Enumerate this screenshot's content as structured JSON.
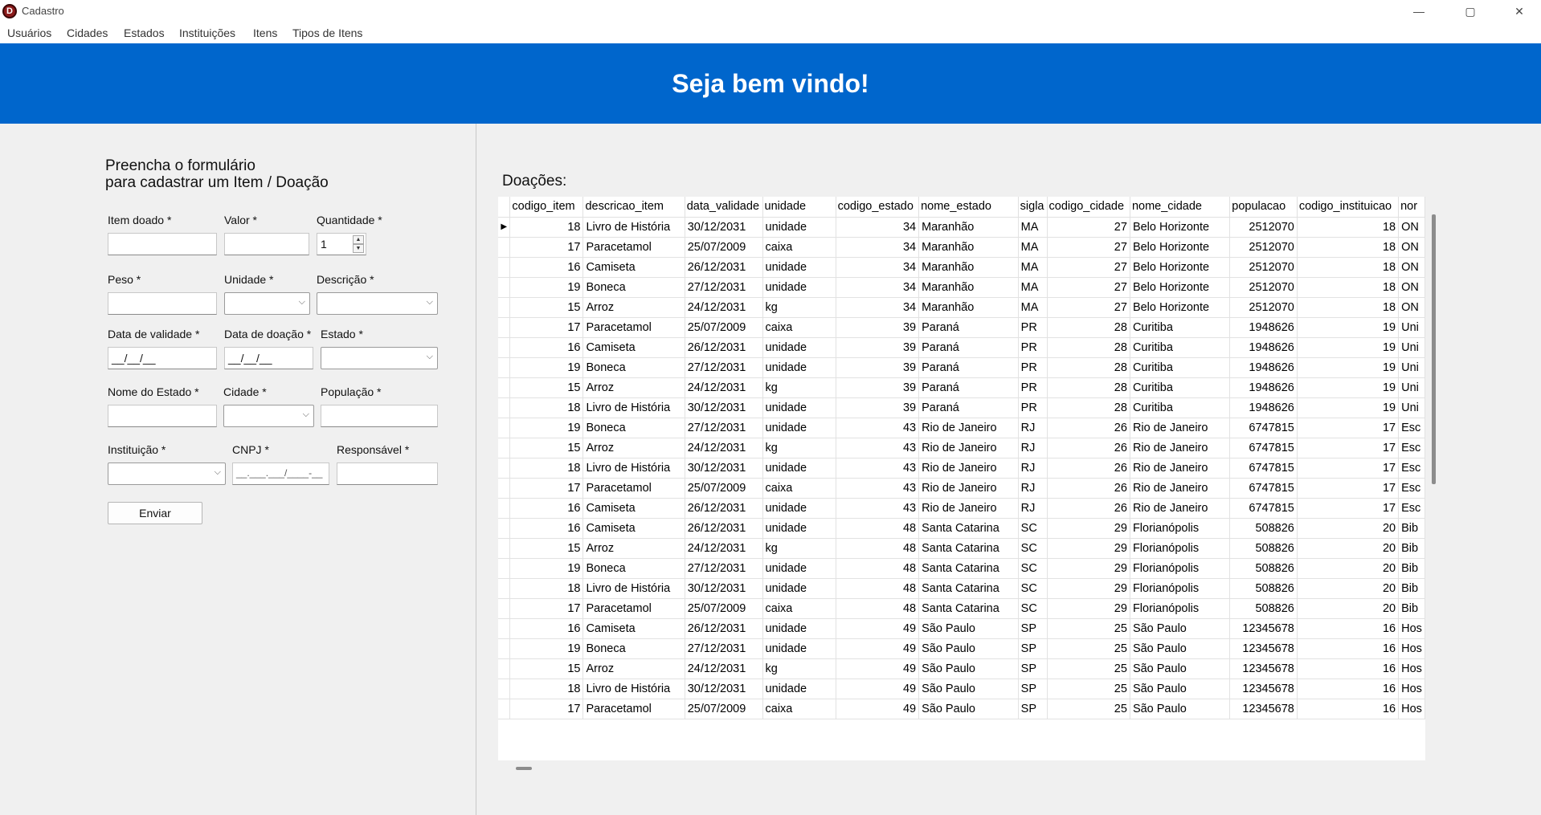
{
  "window": {
    "title": "Cadastro",
    "minimize": "—",
    "maximize": "▢",
    "close": "✕"
  },
  "menu": [
    "Usuários",
    "Cidades",
    "Estados",
    "Instituições",
    "Itens",
    "Tipos de Itens"
  ],
  "banner": {
    "title": "Seja bem vindo!",
    "color": "#0066cc"
  },
  "form": {
    "heading_line1": "Preencha o formulário",
    "heading_line2": "para cadastrar um Item / Doação",
    "labels": {
      "item_doado": "Item doado *",
      "valor": "Valor *",
      "quantidade": "Quantidade *",
      "peso": "Peso *",
      "unidade": "Unidade *",
      "descricao": "Descrição *",
      "data_validade": "Data de validade *",
      "data_doacao": "Data de doação *",
      "estado": "Estado *",
      "nome_estado": "Nome do Estado *",
      "cidade": "Cidade *",
      "populacao": "População *",
      "instituicao": "Instituição *",
      "cnpj": "CNPJ *",
      "responsavel": "Responsável *"
    },
    "values": {
      "quantidade": "1",
      "data_validade_mask": "__/__/__",
      "data_doacao_mask": "__/__/__",
      "cnpj_mask": "__.___.___/____-__"
    },
    "submit": "Enviar"
  },
  "grid": {
    "title": "Doações:",
    "columns": [
      "codigo_item",
      "descricao_item",
      "data_validade",
      "unidade",
      "codigo_estado",
      "nome_estado",
      "sigla",
      "codigo_cidade",
      "nome_cidade",
      "populacao",
      "codigo_instituicao",
      "nor"
    ],
    "rows": [
      [
        "18",
        "Livro de História",
        "30/12/2031",
        "unidade",
        "34",
        "Maranhão",
        "MA",
        "27",
        "Belo Horizonte",
        "2512070",
        "18",
        "ON"
      ],
      [
        "17",
        "Paracetamol",
        "25/07/2009",
        "caixa",
        "34",
        "Maranhão",
        "MA",
        "27",
        "Belo Horizonte",
        "2512070",
        "18",
        "ON"
      ],
      [
        "16",
        "Camiseta",
        "26/12/2031",
        "unidade",
        "34",
        "Maranhão",
        "MA",
        "27",
        "Belo Horizonte",
        "2512070",
        "18",
        "ON"
      ],
      [
        "19",
        "Boneca",
        "27/12/2031",
        "unidade",
        "34",
        "Maranhão",
        "MA",
        "27",
        "Belo Horizonte",
        "2512070",
        "18",
        "ON"
      ],
      [
        "15",
        "Arroz",
        "24/12/2031",
        "kg",
        "34",
        "Maranhão",
        "MA",
        "27",
        "Belo Horizonte",
        "2512070",
        "18",
        "ON"
      ],
      [
        "17",
        "Paracetamol",
        "25/07/2009",
        "caixa",
        "39",
        "Paraná",
        "PR",
        "28",
        "Curitiba",
        "1948626",
        "19",
        "Uni"
      ],
      [
        "16",
        "Camiseta",
        "26/12/2031",
        "unidade",
        "39",
        "Paraná",
        "PR",
        "28",
        "Curitiba",
        "1948626",
        "19",
        "Uni"
      ],
      [
        "19",
        "Boneca",
        "27/12/2031",
        "unidade",
        "39",
        "Paraná",
        "PR",
        "28",
        "Curitiba",
        "1948626",
        "19",
        "Uni"
      ],
      [
        "15",
        "Arroz",
        "24/12/2031",
        "kg",
        "39",
        "Paraná",
        "PR",
        "28",
        "Curitiba",
        "1948626",
        "19",
        "Uni"
      ],
      [
        "18",
        "Livro de História",
        "30/12/2031",
        "unidade",
        "39",
        "Paraná",
        "PR",
        "28",
        "Curitiba",
        "1948626",
        "19",
        "Uni"
      ],
      [
        "19",
        "Boneca",
        "27/12/2031",
        "unidade",
        "43",
        "Rio de Janeiro",
        "RJ",
        "26",
        "Rio de Janeiro",
        "6747815",
        "17",
        "Esc"
      ],
      [
        "15",
        "Arroz",
        "24/12/2031",
        "kg",
        "43",
        "Rio de Janeiro",
        "RJ",
        "26",
        "Rio de Janeiro",
        "6747815",
        "17",
        "Esc"
      ],
      [
        "18",
        "Livro de História",
        "30/12/2031",
        "unidade",
        "43",
        "Rio de Janeiro",
        "RJ",
        "26",
        "Rio de Janeiro",
        "6747815",
        "17",
        "Esc"
      ],
      [
        "17",
        "Paracetamol",
        "25/07/2009",
        "caixa",
        "43",
        "Rio de Janeiro",
        "RJ",
        "26",
        "Rio de Janeiro",
        "6747815",
        "17",
        "Esc"
      ],
      [
        "16",
        "Camiseta",
        "26/12/2031",
        "unidade",
        "43",
        "Rio de Janeiro",
        "RJ",
        "26",
        "Rio de Janeiro",
        "6747815",
        "17",
        "Esc"
      ],
      [
        "16",
        "Camiseta",
        "26/12/2031",
        "unidade",
        "48",
        "Santa Catarina",
        "SC",
        "29",
        "Florianópolis",
        "508826",
        "20",
        "Bib"
      ],
      [
        "15",
        "Arroz",
        "24/12/2031",
        "kg",
        "48",
        "Santa Catarina",
        "SC",
        "29",
        "Florianópolis",
        "508826",
        "20",
        "Bib"
      ],
      [
        "19",
        "Boneca",
        "27/12/2031",
        "unidade",
        "48",
        "Santa Catarina",
        "SC",
        "29",
        "Florianópolis",
        "508826",
        "20",
        "Bib"
      ],
      [
        "18",
        "Livro de História",
        "30/12/2031",
        "unidade",
        "48",
        "Santa Catarina",
        "SC",
        "29",
        "Florianópolis",
        "508826",
        "20",
        "Bib"
      ],
      [
        "17",
        "Paracetamol",
        "25/07/2009",
        "caixa",
        "48",
        "Santa Catarina",
        "SC",
        "29",
        "Florianópolis",
        "508826",
        "20",
        "Bib"
      ],
      [
        "16",
        "Camiseta",
        "26/12/2031",
        "unidade",
        "49",
        "São Paulo",
        "SP",
        "25",
        "São Paulo",
        "12345678",
        "16",
        "Hos"
      ],
      [
        "19",
        "Boneca",
        "27/12/2031",
        "unidade",
        "49",
        "São Paulo",
        "SP",
        "25",
        "São Paulo",
        "12345678",
        "16",
        "Hos"
      ],
      [
        "15",
        "Arroz",
        "24/12/2031",
        "kg",
        "49",
        "São Paulo",
        "SP",
        "25",
        "São Paulo",
        "12345678",
        "16",
        "Hos"
      ],
      [
        "18",
        "Livro de História",
        "30/12/2031",
        "unidade",
        "49",
        "São Paulo",
        "SP",
        "25",
        "São Paulo",
        "12345678",
        "16",
        "Hos"
      ],
      [
        "17",
        "Paracetamol",
        "25/07/2009",
        "caixa",
        "49",
        "São Paulo",
        "SP",
        "25",
        "São Paulo",
        "12345678",
        "16",
        "Hos"
      ]
    ],
    "numeric_columns": [
      0,
      4,
      7,
      9,
      10
    ],
    "current_row_marker": "▶"
  }
}
